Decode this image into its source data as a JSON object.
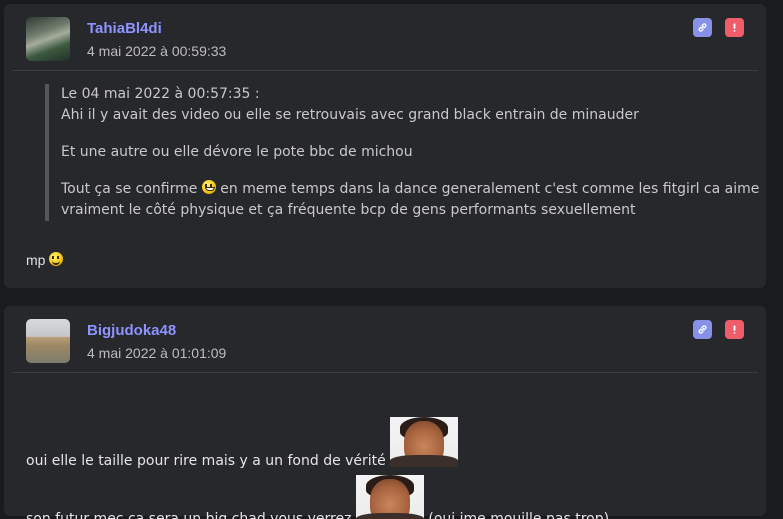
{
  "posts": [
    {
      "username": "TahiaBl4di",
      "date": "4 mai 2022 à 00:59:33",
      "quote": {
        "header": "Le 04 mai 2022 à 00:57:35 :",
        "line1": "Ahi il y avait des video ou elle se retrouvais avec grand black entrain de minauder",
        "line2": "Et une autre ou elle dévore le pote bbc de michou",
        "line3_before": "Tout ça se confirme",
        "line3_after": "en meme temps dans la dance generalement c'est comme les fitgirl ca aime",
        "line4": "vraiment le côté physique et ça fréquente bcp de gens performants sexuellement"
      },
      "reply": "mp"
    },
    {
      "username": "Bigjudoka48",
      "date": "4 mai 2022 à 01:01:09",
      "line1": "oui elle le taille pour rire mais y a un fond de vérité",
      "line2_before": "son futur mec ça sera un big chad vous verrez",
      "line2_after": "(oui jme mouille pas trop)"
    }
  ],
  "icons": {
    "link": "link-icon",
    "report": "exclamation-icon"
  },
  "colors": {
    "username": "#8d93ff",
    "link_button": "#8891e8",
    "report_button": "#ef5d6a",
    "card": "#27282b",
    "background": "#1a1b1e"
  }
}
